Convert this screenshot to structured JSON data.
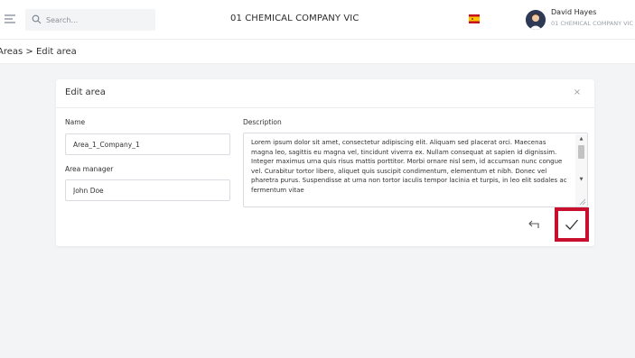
{
  "header": {
    "search_placeholder": "Search...",
    "company_title": "01 CHEMICAL COMPANY VIC",
    "user_name": "David Hayes",
    "user_company": "01 CHEMICAL COMPANY VIC",
    "menu_icon": "hamburger-icon",
    "search_icon": "search-icon",
    "flag_icon": "spain-flag-icon"
  },
  "breadcrumb": {
    "text": "Areas > Edit area"
  },
  "dialog": {
    "title": "Edit area",
    "close_label": "×",
    "name_label": "Name",
    "name_value": "Area_1_Company_1",
    "manager_label": "Area manager",
    "manager_value": "John Doe",
    "description_label": "Description",
    "description_value": "Lorem ipsum dolor sit amet, consectetur adipiscing elit. Aliquam sed placerat orci. Maecenas magna leo, sagittis eu magna vel, tincidunt viverra ex. Nullam consequat at sapien id dignissim. Integer maximus urna quis risus mattis porttitor. Morbi ornare nisl sem, id accumsan nunc congue vel. Curabitur tortor libero, aliquet quis suscipit condimentum, elementum et nibh. Donec vel pharetra purus. Suspendisse at urna non tortor iaculis tempor lacinia et turpis, in leo elit sodales ac fermentum vitae",
    "back_icon": "back-arrow-icon",
    "confirm_icon": "checkmark-icon"
  },
  "colors": {
    "highlight": "#c8102e",
    "background": "#f3f4f6",
    "avatar": "#2e3a55"
  }
}
